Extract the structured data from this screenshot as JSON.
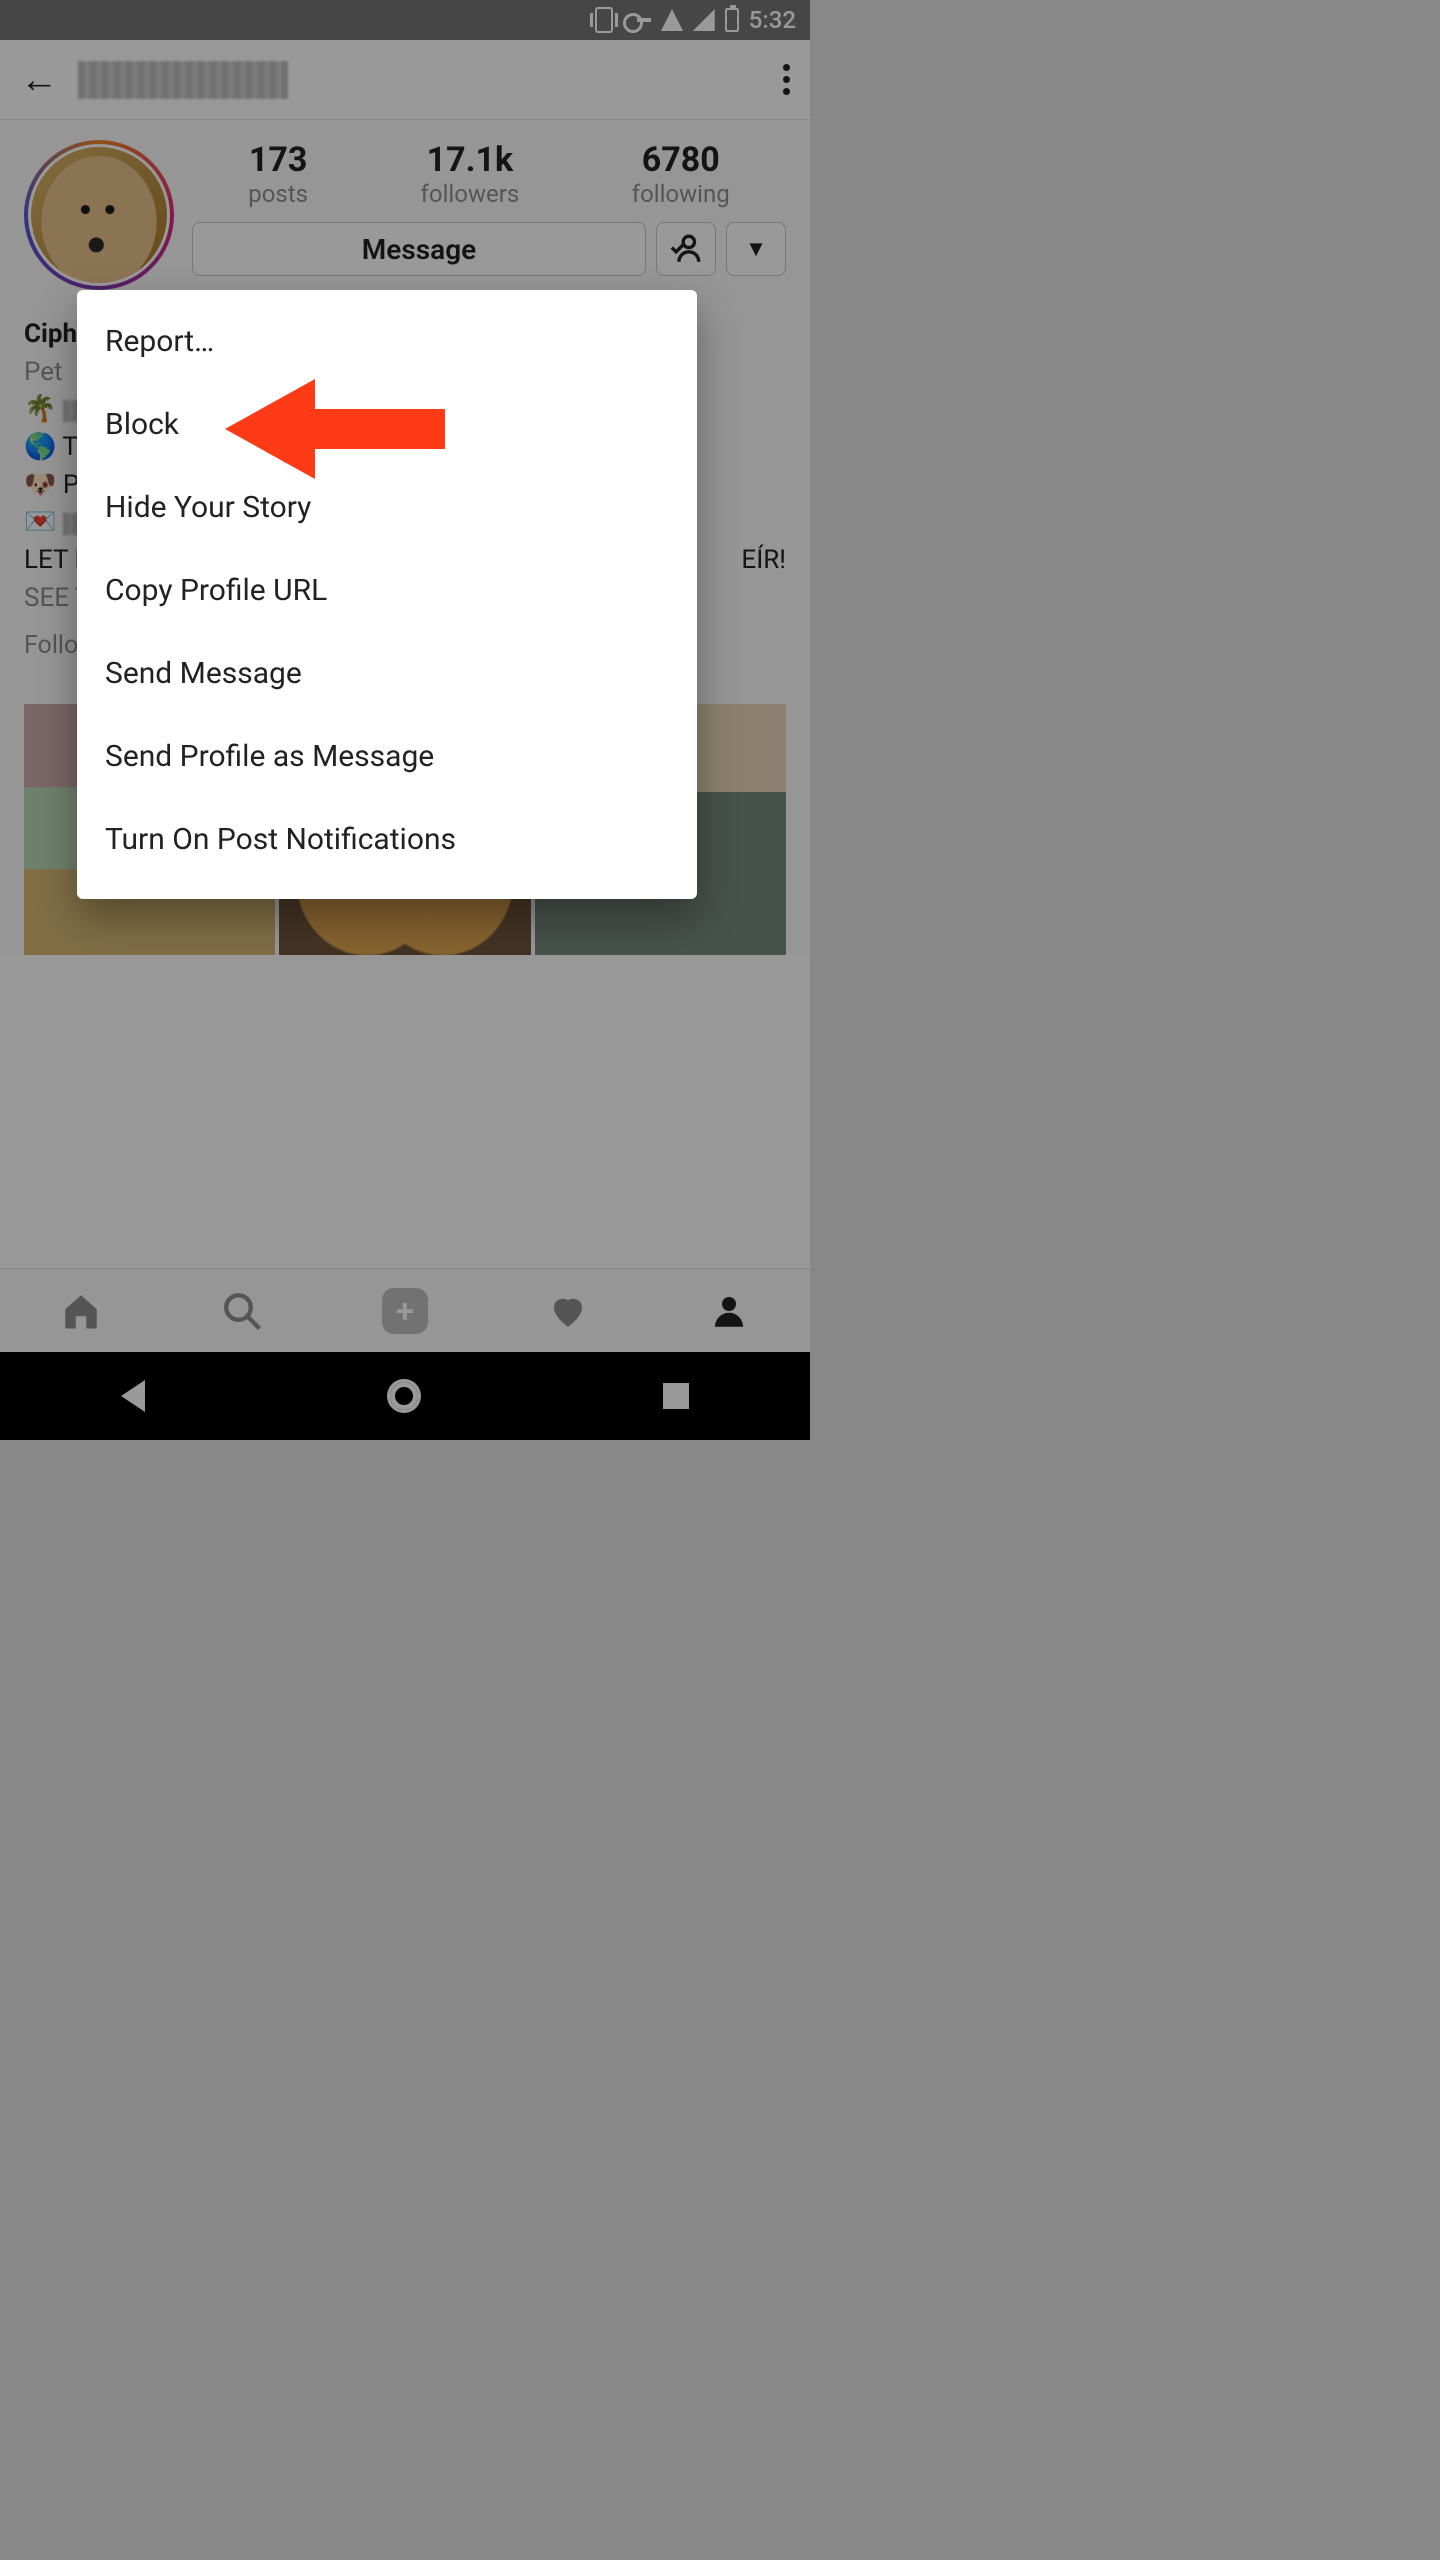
{
  "status": {
    "time": "5:32"
  },
  "header": {
    "username_hidden": true
  },
  "profile": {
    "posts": "173",
    "posts_label": "posts",
    "followers": "17.1k",
    "followers_label": "followers",
    "following": "6780",
    "following_label": "following",
    "message_btn": "Message",
    "display_name": "Cipher",
    "category": "Pet",
    "bio_lines": {
      "l1_emoji": "🌴",
      "l2_emoji": "🌎",
      "l2_text": "Tr",
      "l3_emoji": "🐶",
      "l3_text": "Pu",
      "l4_emoji": "💌"
    },
    "shout": "LET M",
    "shout_tail": "EÍR!",
    "see_t": "SEE T",
    "followed_by": "Follow"
  },
  "modal": {
    "items": [
      "Report…",
      "Block",
      "Hide Your Story",
      "Copy Profile URL",
      "Send Message",
      "Send Profile as Message",
      "Turn On Post Notifications"
    ]
  }
}
